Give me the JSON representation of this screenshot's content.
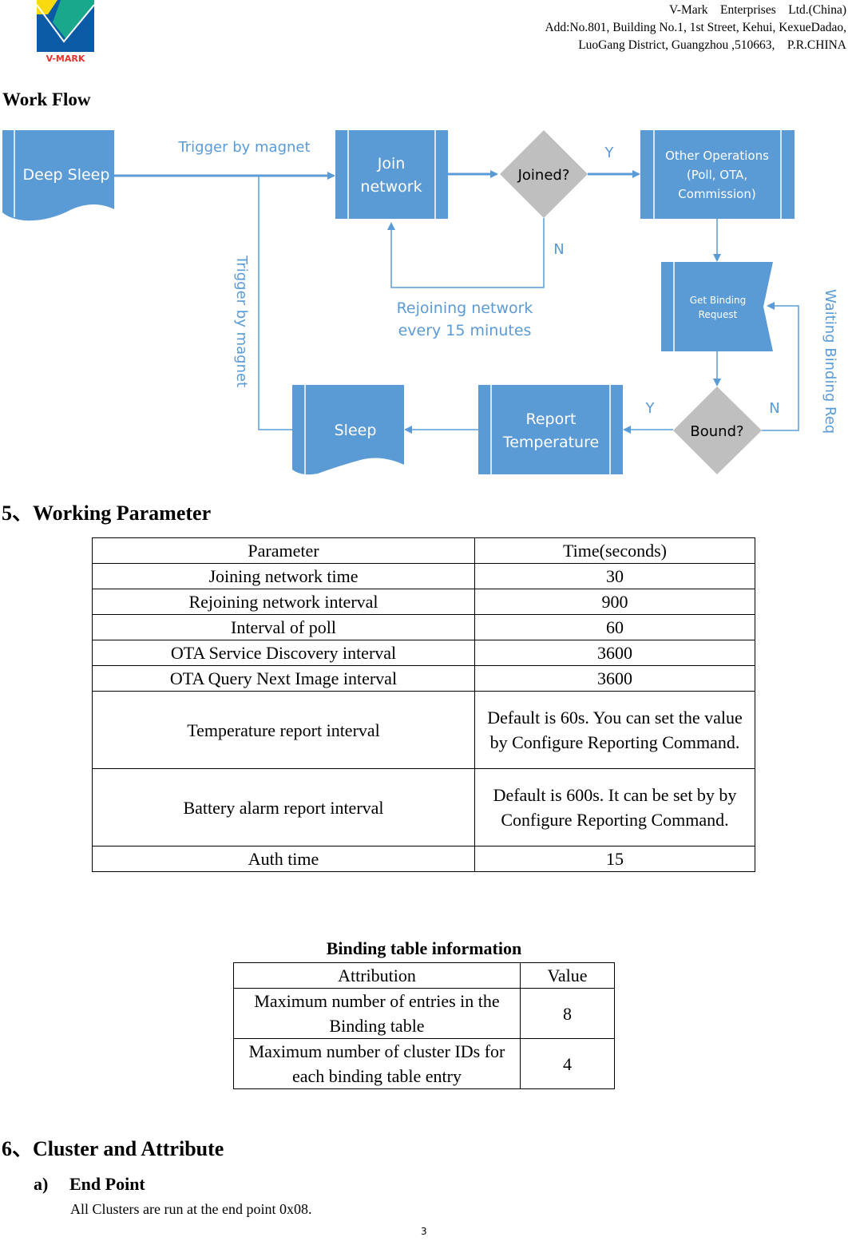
{
  "header": {
    "company": "V-Mark    Enterprises    Ltd.(China)",
    "address_line1": "Add:No.801, Building No.1, 1st Street, Kehui, KexueDadao,",
    "address_line2": "LuoGang District, Guangzhou ,510663,    P.R.CHINA",
    "logo_text": "V-MARK",
    "colors": {
      "logo_yellow": "#f9d90f",
      "logo_teal": "#1aa88c",
      "logo_blue": "#0a5aa5",
      "logo_red": "#e8332a"
    }
  },
  "workflow": {
    "heading": "Work Flow",
    "colors": {
      "shape_fill": "#5b9bd5",
      "decision_fill": "#bfbfbf",
      "label_color": "#5b9bd5"
    },
    "nodes": {
      "deep_sleep": "Deep Sleep",
      "join_line1": "Join",
      "join_line2": "network",
      "joined": "Joined?",
      "other_line1": "Other Operations",
      "other_line2": "(Poll, OTA,",
      "other_line3": "Commission)",
      "binding_line1": "Get Binding",
      "binding_line2": "Request",
      "bound": "Bound?",
      "report_line1": "Report",
      "report_line2": "Temperature",
      "sleep": "Sleep"
    },
    "labels": {
      "trigger_top": "Trigger by magnet",
      "trigger_vertical": "Trigger by magnet",
      "joined_yes": "Y",
      "joined_no": "N",
      "rejoin_line1": "Rejoining network",
      "rejoin_line2": "every 15 minutes",
      "bound_yes": "Y",
      "bound_no": "N",
      "waiting": "Waiting Binding Req"
    }
  },
  "section5": {
    "heading": "5、Working Parameter",
    "table": {
      "headers": [
        "Parameter",
        "Time(seconds)"
      ],
      "rows": [
        [
          "Joining network time",
          "30"
        ],
        [
          "Rejoining network interval",
          "900"
        ],
        [
          "Interval of poll",
          "60"
        ],
        [
          "OTA Service Discovery interval",
          "3600"
        ],
        [
          "OTA Query Next Image interval",
          "3600"
        ],
        [
          "Temperature report interval",
          "Default is 60s. You can set the value by Configure Reporting Command."
        ],
        [
          "Battery alarm report interval",
          "Default is 600s. It can be set by by Configure Reporting Command."
        ],
        [
          "Auth time",
          "15"
        ]
      ]
    },
    "binding": {
      "title": "Binding table information",
      "headers": [
        "Attribution",
        "Value"
      ],
      "rows": [
        [
          "Maximum number of entries in the Binding table",
          "8"
        ],
        [
          "Maximum number of cluster IDs for each binding table entry",
          "4"
        ]
      ]
    }
  },
  "section6": {
    "heading": "6、Cluster and Attribute",
    "sub_label": "a)",
    "sub_heading": "End Point",
    "paragraph": "All Clusters are run at the end point 0x08."
  },
  "page_number": "3"
}
